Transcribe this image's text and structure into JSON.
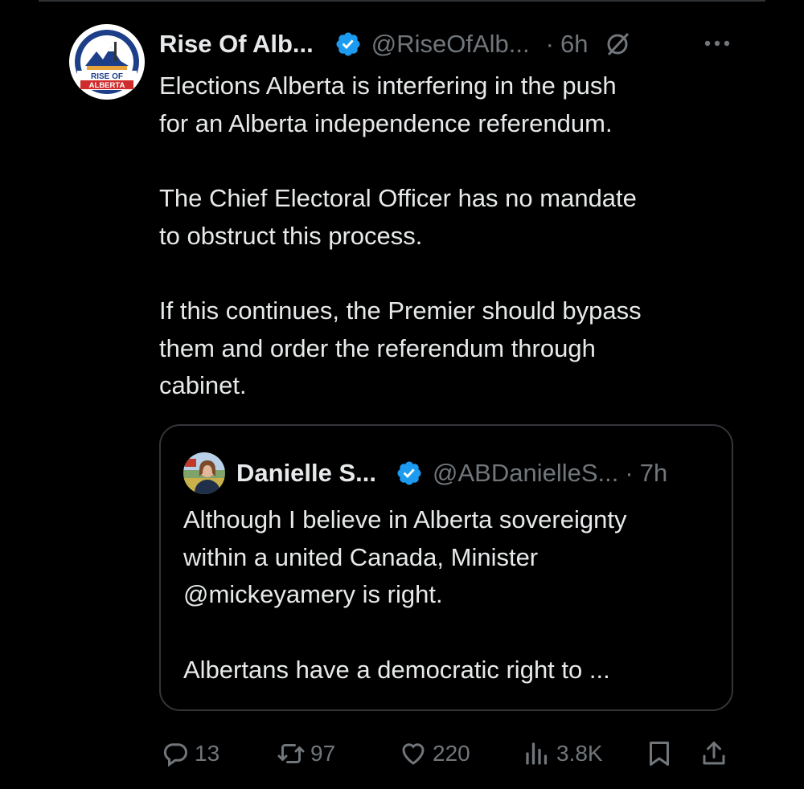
{
  "colors": {
    "background": "#000000",
    "text": "#e7e9ea",
    "muted": "#71767b",
    "verified": "#1d9bf0",
    "border": "#333639"
  },
  "tweet": {
    "avatar_icon": "rise-of-alberta-logo",
    "avatar_text": "RISE OF ALBERTA",
    "name": "Rise Of Alb...",
    "handle": "@RiseOfAlb...",
    "separator": "·",
    "time": "6h",
    "paragraphs": [
      "Elections Alberta is interfering in the push\nfor an Alberta independence referendum.",
      "The Chief Electoral Officer has no mandate\nto obstruct this process.",
      "If this continues, the Premier should bypass\nthem and order the referendum through\ncabinet."
    ]
  },
  "quote": {
    "avatar_icon": "profile-photo",
    "name": "Danielle S...",
    "handle": "@ABDanielleS...",
    "separator": "·",
    "time": "7h",
    "paragraphs": [
      "Although I believe in Alberta sovereignty\nwithin a united Canada, Minister\n@mickeyamery is right.",
      "Albertans have a democratic right to ..."
    ]
  },
  "actions": {
    "replies": "13",
    "reposts": "97",
    "likes": "220",
    "views": "3.8K"
  }
}
